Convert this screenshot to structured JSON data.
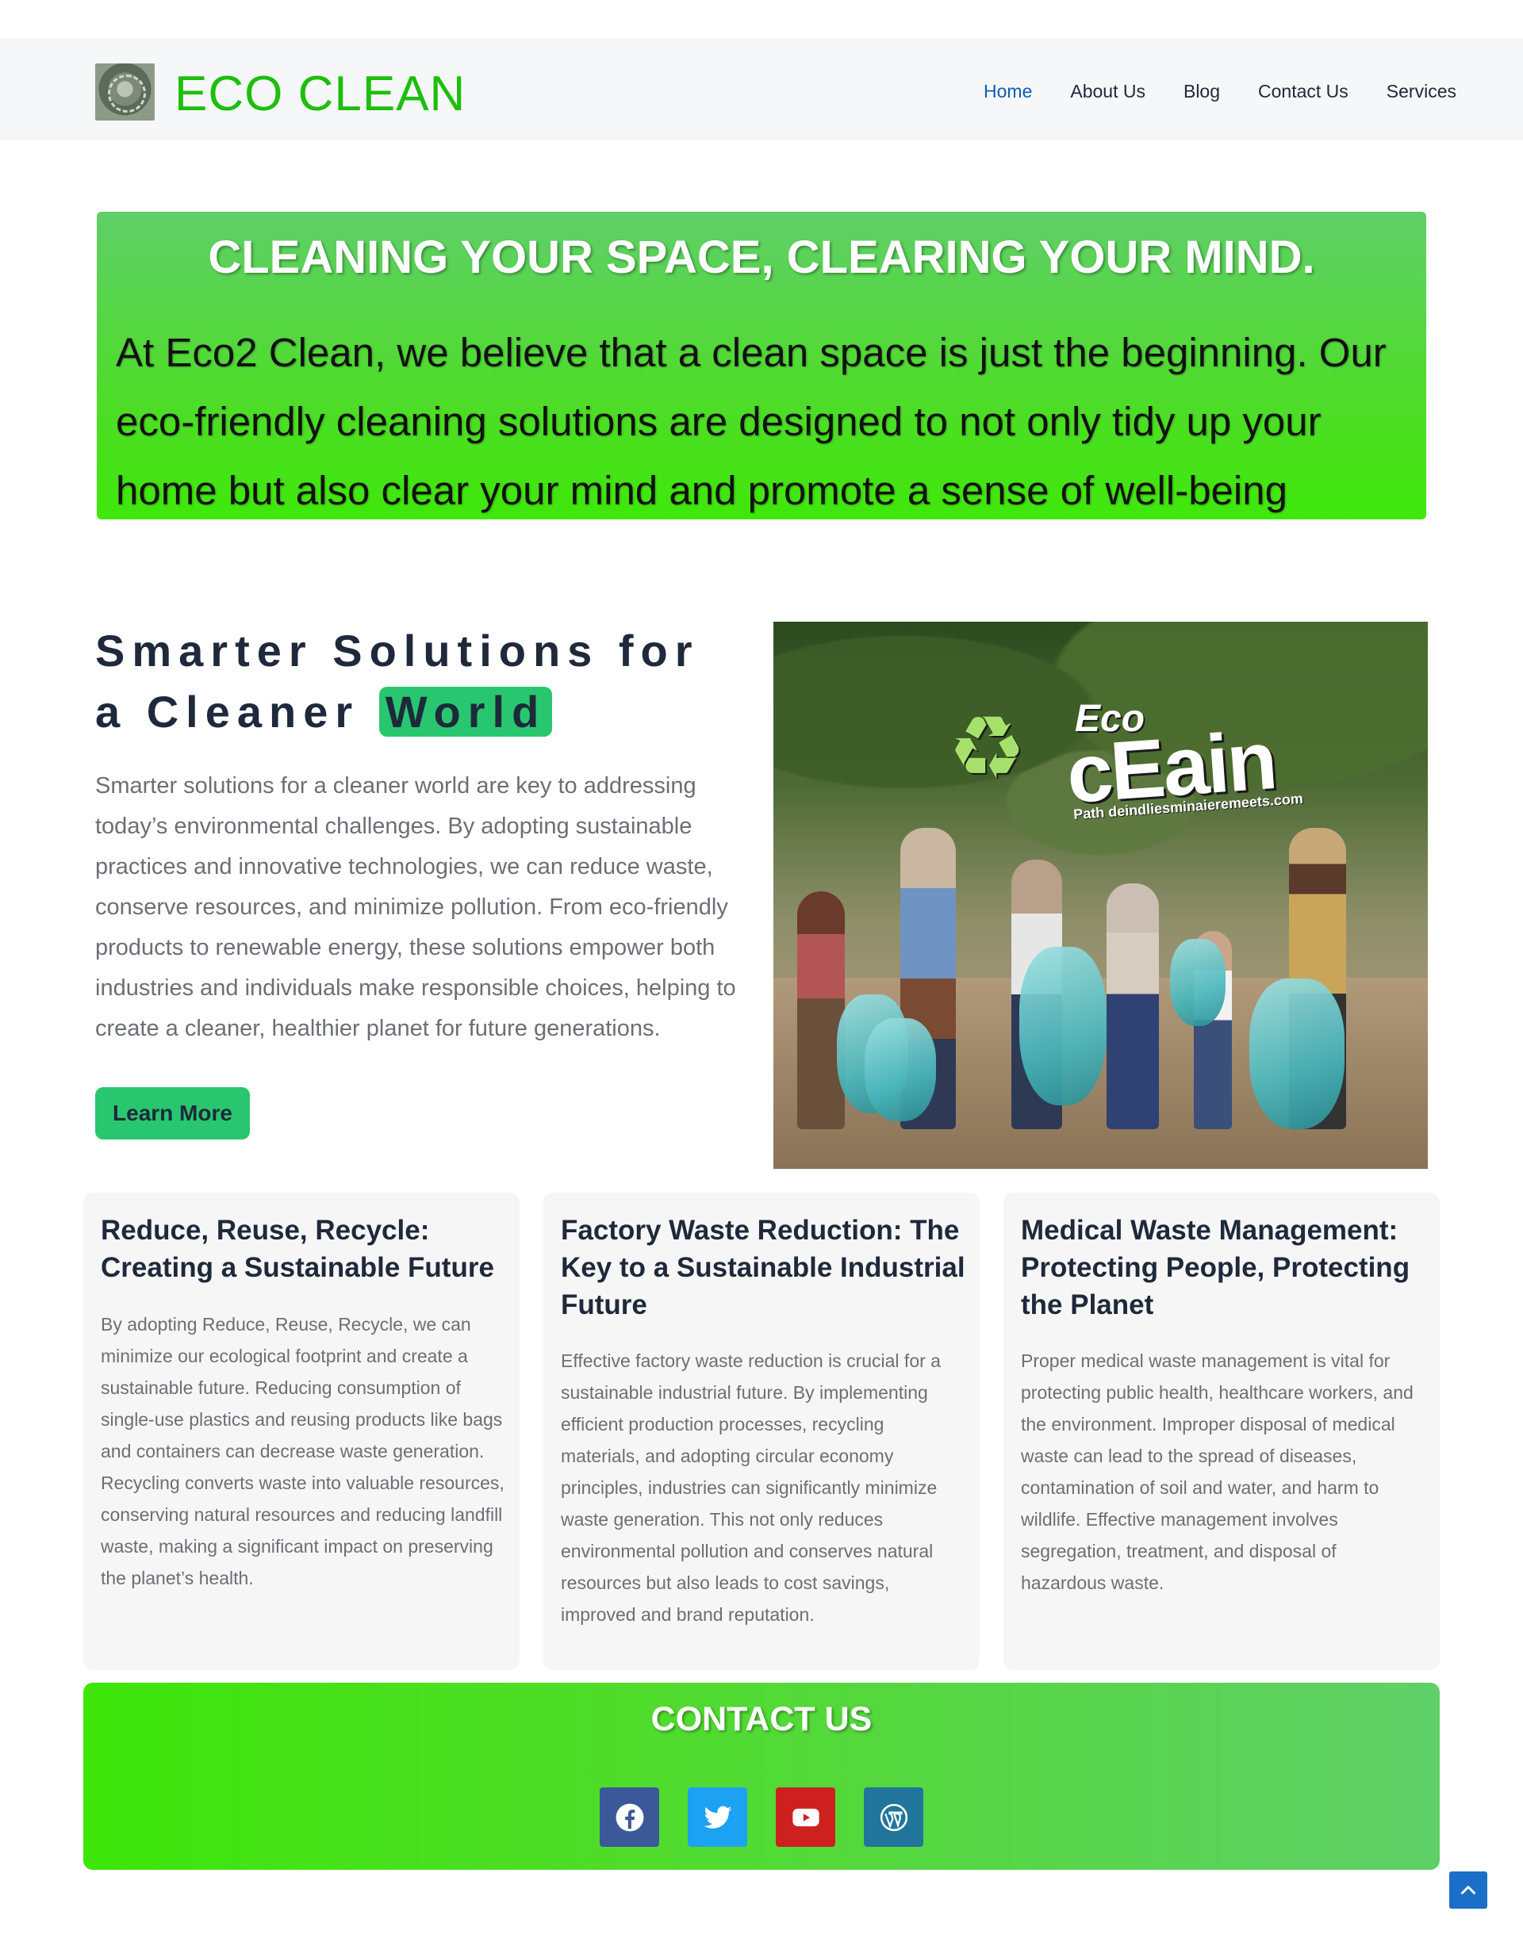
{
  "header": {
    "site_title": "ECO CLEAN",
    "nav": [
      {
        "label": "Home",
        "active": true
      },
      {
        "label": "About Us",
        "active": false
      },
      {
        "label": "Blog",
        "active": false
      },
      {
        "label": "Contact Us",
        "active": false
      },
      {
        "label": "Services",
        "active": false
      }
    ]
  },
  "hero": {
    "title": "CLEANING YOUR SPACE, CLEARING YOUR MIND.",
    "text": "At Eco2 Clean, we believe that a clean space is just the beginning. Our eco-friendly cleaning solutions are designed to not only tidy up your home but also clear your mind and promote a sense of well-being"
  },
  "solutions": {
    "title_part1": "Smarter Solutions for a Cleaner",
    "title_highlight": "World",
    "text": "Smarter solutions for a cleaner world are key to addressing today’s environmental challenges. By adopting sustainable practices and innovative technologies, we can reduce waste, conserve resources, and minimize pollution. From eco-friendly products to renewable energy, these solutions empower both industries and individuals make responsible choices, helping to create a cleaner, healthier planet for future generations.",
    "button_label": "Learn More",
    "image": {
      "eco": "Eco",
      "clean": "cEain",
      "tagline": "Path deindliesminaieremeets.com"
    }
  },
  "cards": [
    {
      "title": "Reduce, Reuse, Recycle: Creating a Sustainable Future",
      "text": "By adopting Reduce, Reuse, Recycle, we can minimize our ecological footprint and create a sustainable future. Reducing consumption of single-use plastics and reusing products like bags and containers can decrease waste generation. Recycling converts waste into valuable resources, conserving natural resources and reducing landfill waste, making a significant impact on preserving the planet’s health."
    },
    {
      "title": "Factory Waste Reduction: The Key to a Sustainable Industrial Future",
      "text": "Effective factory waste reduction is crucial for a sustainable industrial future. By implementing efficient production processes, recycling materials, and adopting circular economy principles, industries can significantly minimize waste generation. This not only reduces environmental pollution and conserves natural resources but also leads to cost savings, improved and brand reputation."
    },
    {
      "title": "Medical Waste Management: Protecting People, Protecting the Planet",
      "text": "Proper medical waste management is vital for protecting public health, healthcare workers, and the environment. Improper disposal of medical waste can lead to the spread of diseases, contamination of soil and water, and harm to wildlife. Effective management involves segregation, treatment, and disposal of hazardous waste."
    }
  ],
  "contact": {
    "title": "CONTACT US",
    "socials": [
      {
        "icon": "facebook-icon",
        "color": "#3b5998"
      },
      {
        "icon": "twitter-icon",
        "color": "#1da1f2"
      },
      {
        "icon": "youtube-icon",
        "color": "#cd201f"
      },
      {
        "icon": "wordpress-icon",
        "color": "#21759b"
      }
    ]
  },
  "colors": {
    "brand_green": "#1cbf0c",
    "accent_green": "#28c76f",
    "nav_active": "#0b5fb0",
    "scroll_top": "#1b6fc8"
  }
}
